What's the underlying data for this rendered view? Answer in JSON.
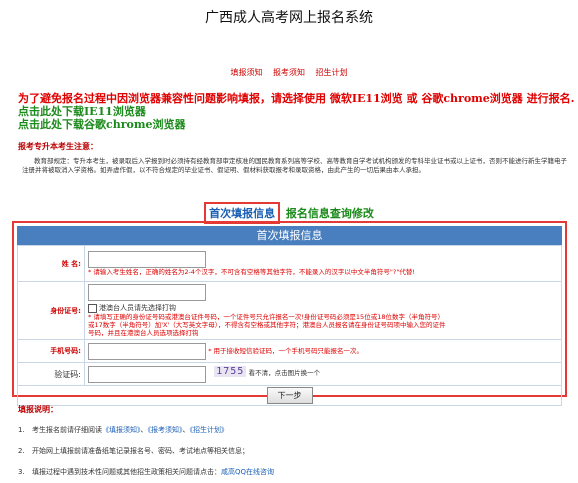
{
  "header": {
    "title": "广西成人高考网上报名系统"
  },
  "nav_links": [
    "填报须知",
    "报考须知",
    "招生计划"
  ],
  "notice": {
    "line1": "为了避免报名过程中因浏览器兼容性问题影响填报，请选择使用 微软IE11浏览 或 谷歌chrome浏览器 进行报名.",
    "link_ie": "点击此处下载IE11浏览器",
    "link_chrome": "点击此处下载谷歌chrome浏览器"
  },
  "upgrade": {
    "title": "报考专升本考生注意：",
    "text": "教育部规定：专升本考生，被录取后入学报到时必须持有经教育部审定核准的国民教育系列高等学校、高等教育自学考试机构颁发的专科毕业证书或以上证书，否则不能进行新生学籍电子注册并将被取消入学资格。如弄虚作假，以不符合规定的毕业证书、假证明、假材料获取报考和录取资格，由此产生的一切后果由本人承担。"
  },
  "tabs": {
    "active": "首次填报信息",
    "other": "报名信息查询修改"
  },
  "form": {
    "heading": "首次填报信息",
    "name_label": "姓 名:",
    "name_hint": "* 请输入考生姓名，正确的姓名为2-4个汉字，不可含有空格等其他字符，不能录入的汉字以中文半角符号\"?\"代替!",
    "id_label": "身份证号:",
    "id_hint": "* 请填写正确的身份证号码或港澳台证件号码，一个证件号只允许报名一次!身份证号码必须是15位或18位数字（半角符号）或17数字（半角符号）加'X'（大写英文字母），不得含有空格或其他字符；港澳台人员报名请在身份证号码项中输入您的证件号码，并且在港澳台人员选项选择打钩",
    "hk_checkbox": "港澳台人员请先选择打钩",
    "phone_label": "手机号码:",
    "phone_hint": "* 用于接收短信验证码，一个手机号码只能报名一次。",
    "captcha_label": "验证码:",
    "captcha_image_text": "1755",
    "captcha_hint": "看不清，点击图片换一个",
    "next_button": "下一步"
  },
  "instructions": {
    "title": "填报说明：",
    "step1_num": "1.",
    "step1_prefix": "考生报名前请仔细阅读",
    "step1_link1": "《填报须知》",
    "step1_sep1": "、",
    "step1_link2": "《报考须知》",
    "step1_sep2": "、",
    "step1_link3": "《招生计划》",
    "step2_num": "2.",
    "step2": "开始网上填报前请准备纸笔记录报名号、密码、考试地点等相关信息；",
    "step3_num": "3.",
    "step3_prefix": "填报过程中遇到技术性问题或其他招生政策相关问题请点击：",
    "step3_link": "咸高QQ在线咨询"
  },
  "colors": {
    "accent_blue": "#4a7fbf",
    "alert_red": "#e53935",
    "link_green": "#1a8a1a"
  }
}
